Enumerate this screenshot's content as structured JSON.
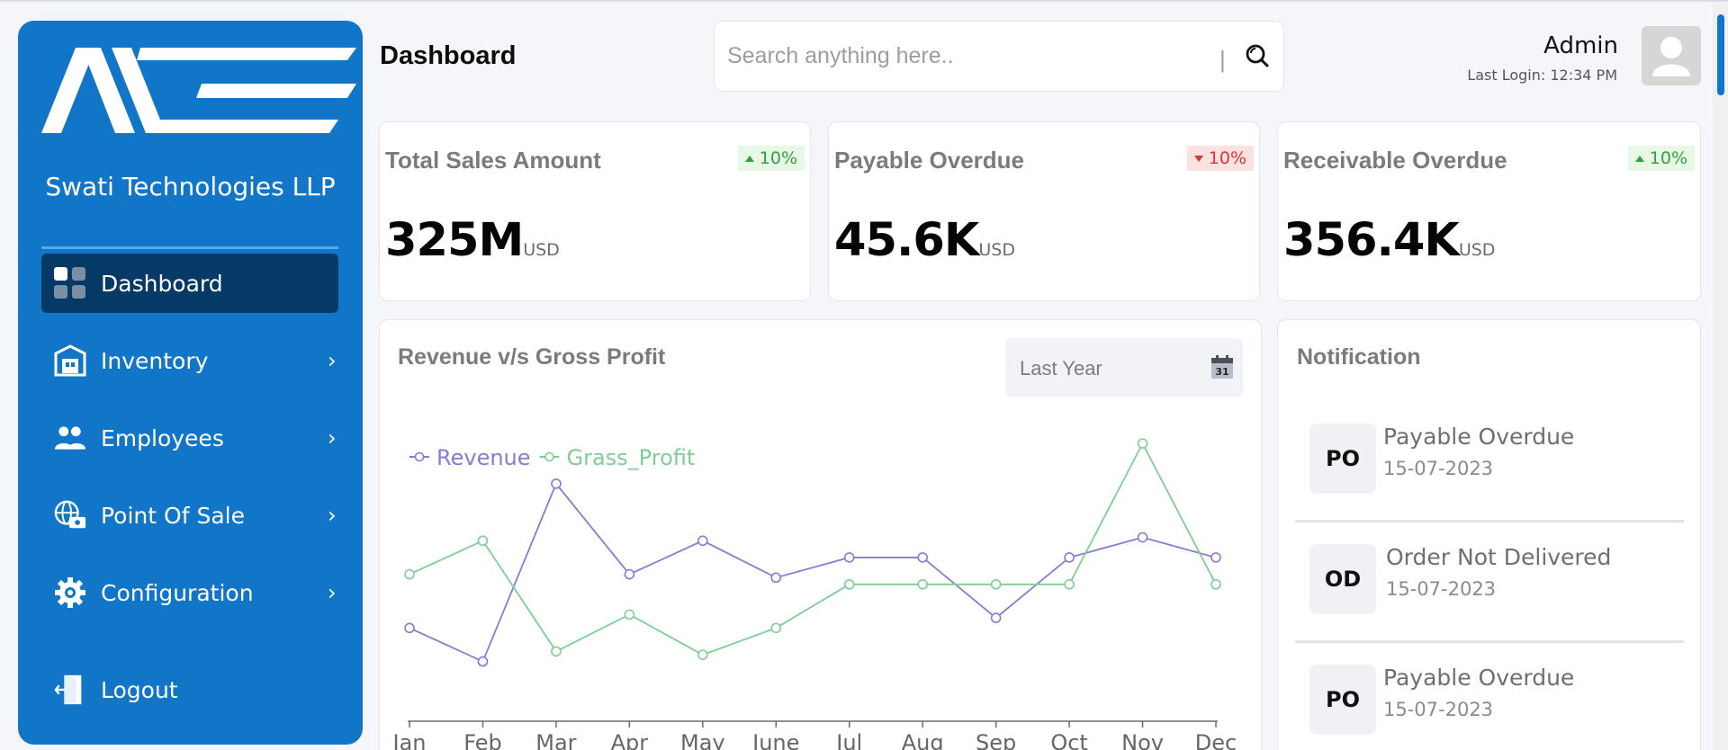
{
  "sidebar": {
    "company": "Swati Technologies LLP",
    "items": [
      {
        "label": "Dashboard",
        "icon": "dashboard-grid-icon",
        "active": true
      },
      {
        "label": "Inventory",
        "icon": "warehouse-icon"
      },
      {
        "label": "Employees",
        "icon": "users-icon"
      },
      {
        "label": "Point Of Sale",
        "icon": "globe-cash-icon"
      },
      {
        "label": "Configuration",
        "icon": "gear-icon"
      }
    ],
    "logout": "Logout"
  },
  "header": {
    "title": "Dashboard",
    "search_placeholder": "Search anything here..",
    "search_separator": "|",
    "user": "Admin",
    "last_login": "Last Login: 12:34 PM"
  },
  "kpis": [
    {
      "title": "Total Sales Amount",
      "value": "325M",
      "unit": "USD",
      "change": "10%",
      "direction": "up"
    },
    {
      "title": "Payable Overdue",
      "value": "45.6K",
      "unit": "USD",
      "change": "10%",
      "direction": "down"
    },
    {
      "title": "Receivable Overdue",
      "value": "356.4K",
      "unit": "USD",
      "change": "10%",
      "direction": "up"
    }
  ],
  "chart_card": {
    "title": "Revenue v/s Gross Profit",
    "filter": "Last Year",
    "calendar_day": "31"
  },
  "chart_data": {
    "type": "line",
    "x": [
      "Jan",
      "Feb",
      "Mar",
      "Apr",
      "May",
      "June",
      "Jul",
      "Aug",
      "Sep",
      "Oct",
      "Nov",
      "Dec"
    ],
    "series": [
      {
        "name": "Revenue",
        "color": "#8a7ad6",
        "values": [
          27,
          17,
          70,
          43,
          53,
          42,
          48,
          48,
          30,
          48,
          54,
          48
        ]
      },
      {
        "name": "Grass_Profit",
        "color": "#7fce94",
        "values": [
          43,
          53,
          20,
          31,
          19,
          27,
          40,
          40,
          40,
          40,
          82,
          40
        ]
      }
    ],
    "legend": "top-left",
    "grid": false,
    "ylim": [
      0,
      100
    ]
  },
  "notifications": {
    "title": "Notification",
    "items": [
      {
        "badge": "PO",
        "text": "Payable Overdue",
        "date": "15-07-2023"
      },
      {
        "badge": "OD",
        "text": "Order Not Delivered",
        "date": "15-07-2023"
      },
      {
        "badge": "PO",
        "text": "Payable Overdue",
        "date": "15-07-2023"
      }
    ]
  },
  "colors": {
    "sidebar": "#1176c8",
    "sidebar_active": "#063a66",
    "accent_up": "#2ea43b",
    "accent_down": "#d73737"
  }
}
